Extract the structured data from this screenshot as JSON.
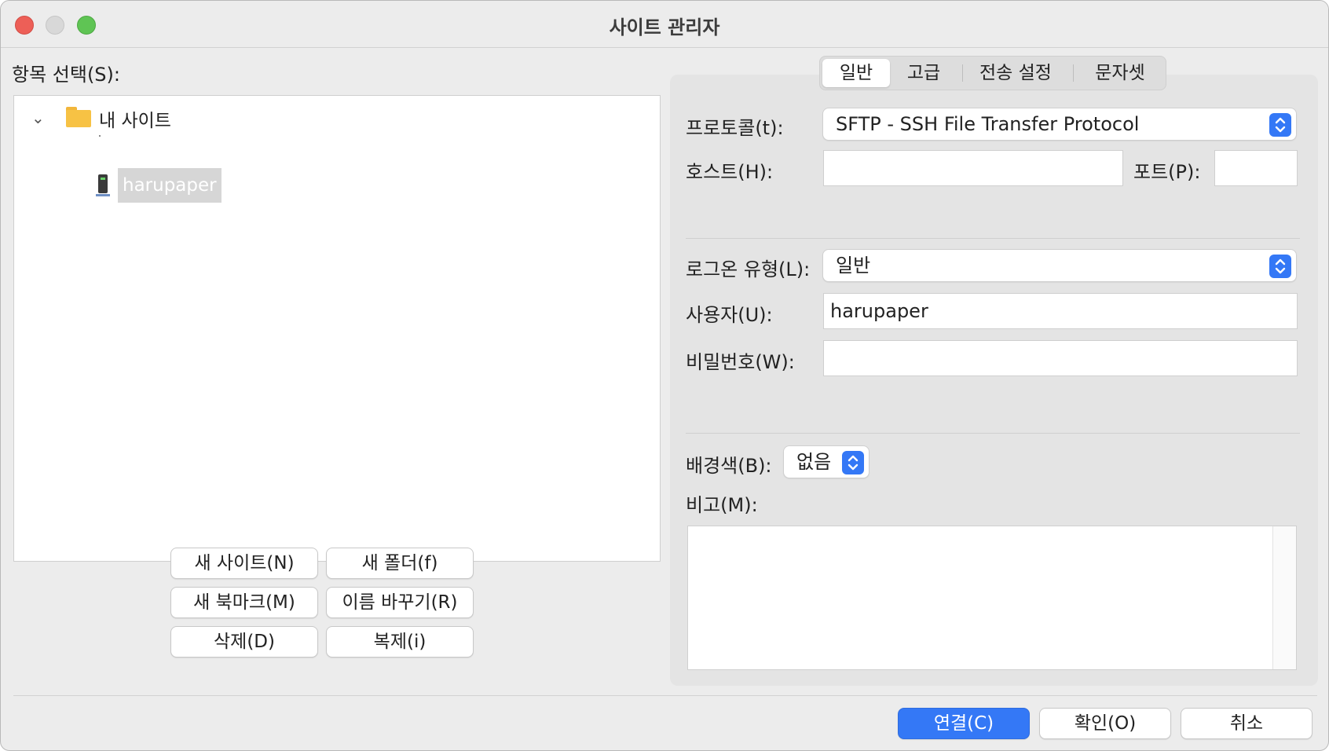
{
  "window": {
    "title": "사이트 관리자"
  },
  "left": {
    "label": "항목 선택(S):",
    "tree": {
      "folder": {
        "label": "내 사이트",
        "icon": "folder-icon"
      },
      "site": {
        "label": "harupaper",
        "icon": "server-icon"
      }
    },
    "buttons": {
      "new_site": "새 사이트(N)",
      "new_folder": "새 폴더(f)",
      "new_bookmark": "새 북마크(M)",
      "rename": "이름 바꾸기(R)",
      "delete": "삭제(D)",
      "duplicate": "복제(i)"
    }
  },
  "tabs": [
    "일반",
    "고급",
    "전송 설정",
    "문자셋"
  ],
  "active_tab": "일반",
  "form": {
    "protocol_label": "프로토콜(t):",
    "protocol_value": "SFTP - SSH File Transfer Protocol",
    "host_label": "호스트(H):",
    "host_value": "",
    "port_label": "포트(P):",
    "port_value": "",
    "logon_type_label": "로그온 유형(L):",
    "logon_type_value": "일반",
    "user_label": "사용자(U):",
    "user_value": "harupaper",
    "password_label": "비밀번호(W):",
    "password_value": "",
    "background_label": "배경색(B):",
    "background_value": "없음",
    "comments_label": "비고(M):",
    "comments_value": ""
  },
  "footer": {
    "connect": "연결(C)",
    "ok": "확인(O)",
    "cancel": "취소"
  },
  "colors": {
    "accent": "#3478f6",
    "window_bg": "#ececec",
    "panel_bg": "#e4e4e4"
  }
}
